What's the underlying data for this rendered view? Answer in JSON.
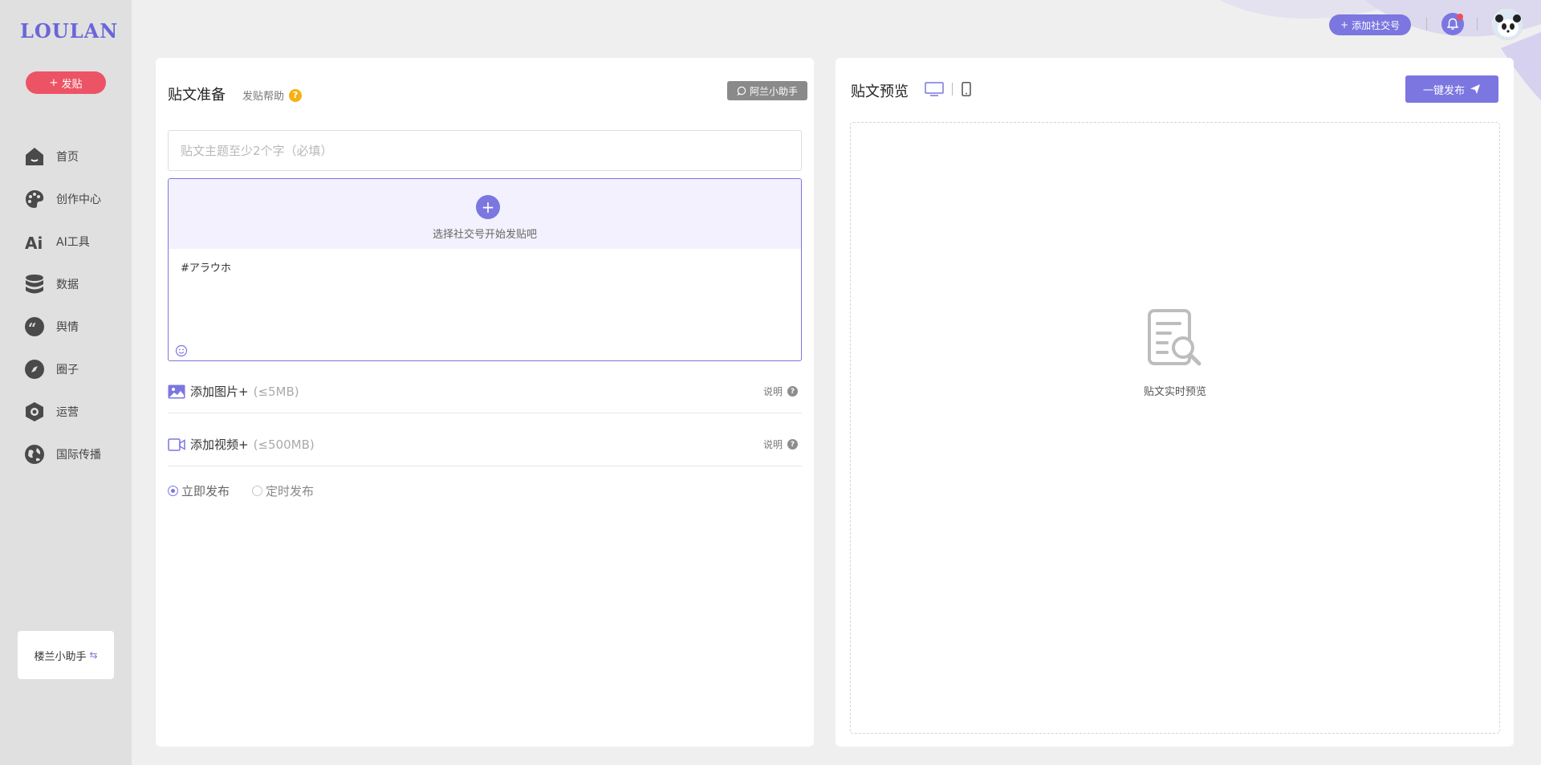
{
  "brand": {
    "logo": "LOULAN",
    "accent": "#7b76e0",
    "post_color": "#ec5466"
  },
  "sidebar": {
    "post_button": "发贴",
    "items": [
      {
        "label": "首页",
        "icon": "home-icon"
      },
      {
        "label": "创作中心",
        "icon": "palette-icon"
      },
      {
        "label": "AI工具",
        "icon": "ai-icon"
      },
      {
        "label": "数据",
        "icon": "database-icon"
      },
      {
        "label": "舆情",
        "icon": "quote-icon"
      },
      {
        "label": "圈子",
        "icon": "compass-icon"
      },
      {
        "label": "运营",
        "icon": "operation-icon"
      },
      {
        "label": "国际传播",
        "icon": "globe-icon"
      }
    ],
    "helper": "楼兰小助手"
  },
  "topbar": {
    "add_social": "添加社交号",
    "has_notification": true
  },
  "compose": {
    "title": "贴文准备",
    "help": "发贴帮助",
    "help_badge": "?",
    "assistant_button": "阿兰小助手",
    "topic_placeholder": "贴文主题至少2个字（必填）",
    "select_tip": "选择社交号开始发贴吧",
    "editor_text": "#アラウホ",
    "add_image": {
      "label": "添加图片+",
      "limit": "(≤5MB)",
      "explain": "说明"
    },
    "add_video": {
      "label": "添加视频+",
      "limit": "(≤500MB)",
      "explain": "说明"
    },
    "publish_modes": [
      {
        "label": "立即发布",
        "selected": true
      },
      {
        "label": "定时发布",
        "selected": false
      }
    ]
  },
  "preview": {
    "title": "贴文预览",
    "publish_button": "一键发布",
    "empty_text": "贴文实时预览",
    "active_device": "desktop"
  }
}
